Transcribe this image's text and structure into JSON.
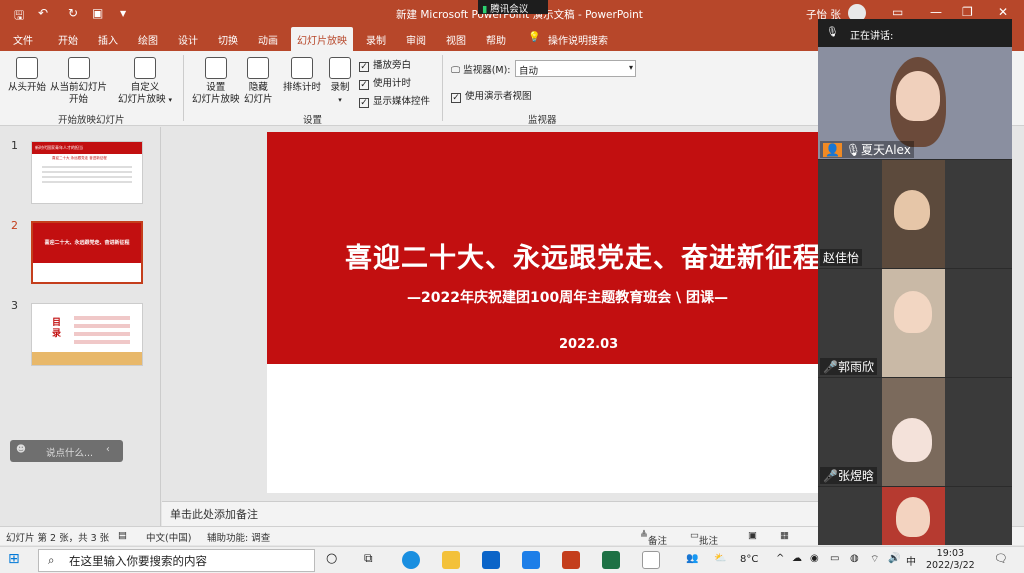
{
  "titlebar": {
    "doc_title": "新建 Microsoft PowerPoint 演示文稿 - PowerPoint",
    "user": "子怡 张",
    "meeting_badge": "腾讯会议",
    "quick_access": [
      "save-icon",
      "undo-icon",
      "redo-icon",
      "present-icon",
      "customize-icon"
    ]
  },
  "tabs": [
    "文件",
    "开始",
    "插入",
    "绘图",
    "设计",
    "切换",
    "动画",
    "幻灯片放映",
    "录制",
    "审阅",
    "视图",
    "帮助",
    "操作说明搜索"
  ],
  "ribbon": {
    "from_start": "从头开始",
    "from_current_1": "从当前幻灯片",
    "from_current_2": "开始",
    "custom_1": "自定义",
    "custom_2": "幻灯片放映",
    "group_start": "开始放映幻灯片",
    "setup_1": "设置",
    "setup_2": "幻灯片放映",
    "hide_1": "隐藏",
    "hide_2": "幻灯片",
    "rehearse": "排练计时",
    "record": "录制",
    "play_narration": "播放旁白",
    "use_timing": "使用计时",
    "show_media": "显示媒体控件",
    "group_setup": "设置",
    "monitor_label": "监视器(M):",
    "monitor_value": "自动",
    "presenter_view": "使用演示者视图",
    "group_monitor": "监视器"
  },
  "slides": [
    {
      "num": "1",
      "title": "新时代国家青年人才的担当",
      "line": "喜迎二十大 永远跟党走 奋进新征程"
    },
    {
      "num": "2",
      "title": "喜迎二十大、永远跟党走、奋进新征程"
    },
    {
      "num": "3",
      "title": "目录"
    }
  ],
  "chat_placeholder": "说点什么...",
  "main_slide": {
    "headline": "喜迎二十大、永远跟党走、奋进新征程",
    "subtitle": "—2022年庆祝建团100周年主题教育班会 \\ 团课—",
    "date": "2022.03",
    "accent": "#c20f10"
  },
  "notes_placeholder": "单击此处添加备注",
  "status": {
    "slide_info": "幻灯片 第 2 张，共 3 张",
    "language": "中文(中国)",
    "accessibility": "辅助功能: 调查",
    "notes_btn": "备注",
    "comments_btn": "批注"
  },
  "meeting": {
    "speaking_label": "正在讲话:",
    "participants": [
      "夏天Alex",
      "赵佳怡",
      "郭雨欣",
      "张煜晗",
      ""
    ]
  },
  "taskbar": {
    "search_placeholder": "在这里输入你要搜索的内容",
    "weather": "8°C",
    "ime": "中",
    "time": "19:03",
    "date": "2022/3/22"
  },
  "colors": {
    "ppt_red": "#b7472a",
    "slide_red": "#c20f10"
  }
}
